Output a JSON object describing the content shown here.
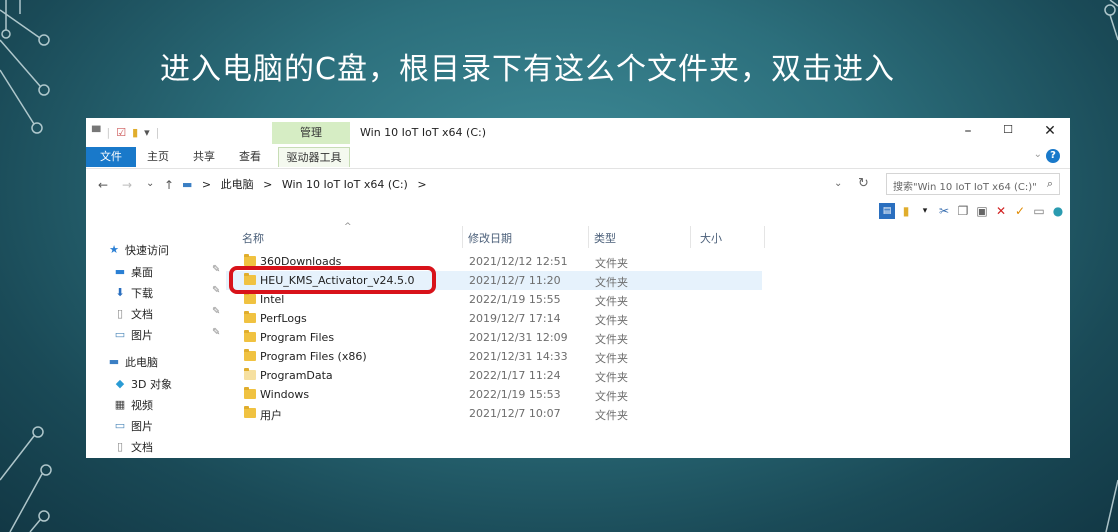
{
  "slide": {
    "instruction": "进入电脑的C盘，根目录下有这么个文件夹，双击进入"
  },
  "window": {
    "title": "Win 10 IoT IoT x64 (C:)",
    "contextual_tab": "管理",
    "controls": {
      "minimize": "–",
      "maximize": "☐",
      "close": "✕"
    },
    "ribbon_tabs": [
      "文件",
      "主页",
      "共享",
      "查看",
      "驱动器工具"
    ],
    "help": "?"
  },
  "navigation": {
    "back": "←",
    "forward": "→",
    "recent": "⌄",
    "up": "↑",
    "breadcrumb": [
      "此电脑",
      "Win 10 IoT IoT x64 (C:)"
    ],
    "separator": ">",
    "refresh": "↻",
    "search_placeholder": "搜索\"Win 10 IoT IoT x64 (C:)\"",
    "search_icon": "magnifier-icon"
  },
  "sidebar": {
    "quick_access": "快速访问",
    "items": [
      {
        "label": "桌面",
        "icon": "desktop-icon",
        "pinned": true
      },
      {
        "label": "下载",
        "icon": "download-icon",
        "pinned": true
      },
      {
        "label": "文档",
        "icon": "document-icon",
        "pinned": true
      },
      {
        "label": "图片",
        "icon": "picture-icon",
        "pinned": true
      }
    ],
    "this_pc": "此电脑",
    "pc_items": [
      {
        "label": "3D 对象",
        "icon": "3d-objects-icon"
      },
      {
        "label": "视频",
        "icon": "video-icon"
      },
      {
        "label": "图片",
        "icon": "picture-icon"
      },
      {
        "label": "文档",
        "icon": "document-icon"
      }
    ]
  },
  "columns": {
    "name": "名称",
    "date": "修改日期",
    "type": "类型",
    "size": "大小"
  },
  "files": [
    {
      "name": "360Downloads",
      "date": "2021/12/12 12:51",
      "type": "文件夹"
    },
    {
      "name": "HEU_KMS_Activator_v24.5.0",
      "date": "2021/12/7 11:20",
      "type": "文件夹"
    },
    {
      "name": "Intel",
      "date": "2022/1/19 15:55",
      "type": "文件夹"
    },
    {
      "name": "PerfLogs",
      "date": "2019/12/7 17:14",
      "type": "文件夹"
    },
    {
      "name": "Program Files",
      "date": "2021/12/31 12:09",
      "type": "文件夹"
    },
    {
      "name": "Program Files (x86)",
      "date": "2021/12/31 14:33",
      "type": "文件夹"
    },
    {
      "name": "ProgramData",
      "date": "2022/1/17 11:24",
      "type": "文件夹"
    },
    {
      "name": "Windows",
      "date": "2022/1/19 15:53",
      "type": "文件夹"
    },
    {
      "name": "用户",
      "date": "2021/12/7 10:07",
      "type": "文件夹"
    }
  ],
  "selected_file": "HEU_KMS_Activator_v24.5.0",
  "colors": {
    "highlight_border": "#d8121a",
    "file_tab": "#1979ca",
    "manage_tab": "#d6edc4",
    "selection": "#e6f2fc"
  }
}
